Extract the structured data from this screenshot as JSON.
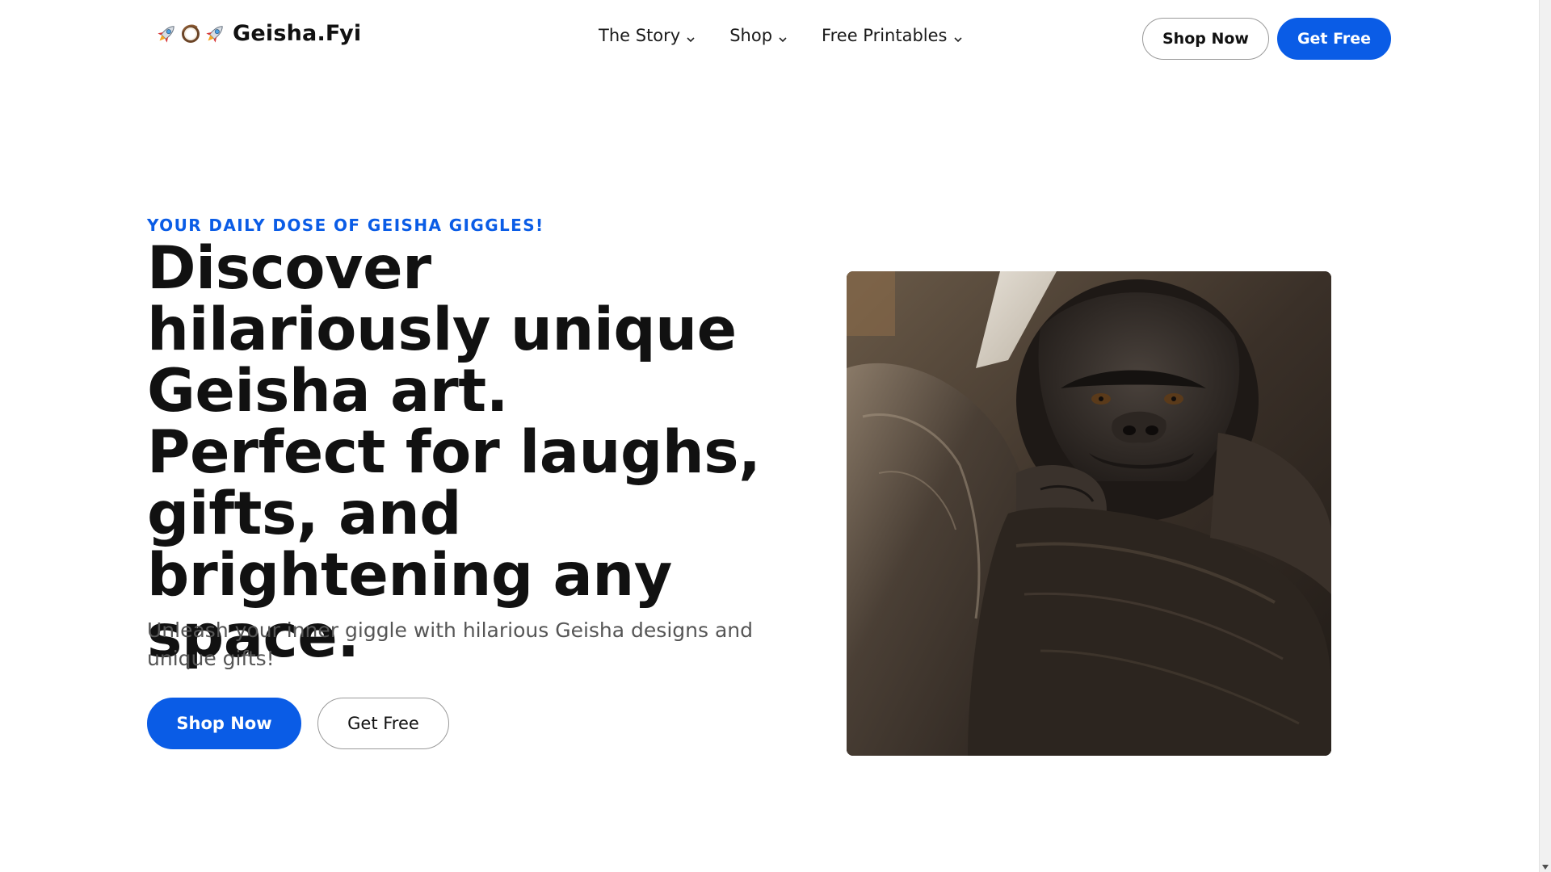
{
  "brand": {
    "emoji_icons": [
      "rocket-icon",
      "coconut-icon",
      "rocket-icon"
    ],
    "name": "Geisha.Fyi"
  },
  "nav": {
    "items": [
      {
        "label": "The Story",
        "icon": "chevron-down-icon"
      },
      {
        "label": "Shop",
        "icon": "chevron-down-icon"
      },
      {
        "label": "Free Printables",
        "icon": "chevron-down-icon"
      }
    ]
  },
  "header": {
    "shop_now_label": "Shop Now",
    "get_free_label": "Get Free"
  },
  "hero": {
    "eyebrow": "YOUR DAILY DOSE OF GEISHA GIGGLES!",
    "headline": "Discover hilariously unique Geisha art. Perfect for laughs, gifts, and brightening any space.",
    "subtext": "Unleash your inner giggle with hilarious Geisha designs and unique gifts!",
    "primary_label": "Shop Now",
    "secondary_label": "Get Free"
  },
  "colors": {
    "accent": "#0a5ce6",
    "text": "#111111",
    "muted_text": "#555555",
    "outline_border": "#9a9a9a"
  }
}
